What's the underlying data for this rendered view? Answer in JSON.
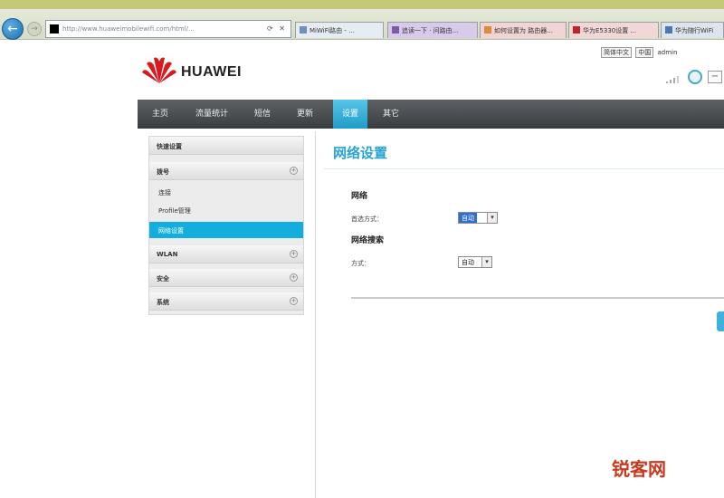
{
  "browser": {
    "address_url": "http://www.huaweimobilewifi.com/html/...",
    "address_controls": "⟳ ✕",
    "tabs": [
      {
        "label": "MiWiFi路由 - ..."
      },
      {
        "label": "追读一下 · 问路由..."
      },
      {
        "label": "如何设置为 路由器..."
      },
      {
        "label": "华为E5330设置 ..."
      },
      {
        "label": "华为随行WiFi"
      }
    ]
  },
  "header": {
    "brand": "HUAWEI",
    "language": "简体中文",
    "user_label": "admin",
    "util_select": "中国"
  },
  "nav": {
    "items": [
      {
        "label": "主页"
      },
      {
        "label": "流量统计"
      },
      {
        "label": "短信"
      },
      {
        "label": "更新"
      },
      {
        "label": "设置"
      },
      {
        "label": "其它"
      }
    ],
    "active_index": 4
  },
  "sidebar": {
    "sections": [
      {
        "label": "快速设置"
      },
      {
        "label": "拨号"
      },
      {
        "label": "WLAN"
      },
      {
        "label": "安全"
      },
      {
        "label": "系统"
      }
    ],
    "subitems": [
      {
        "label": "连接"
      },
      {
        "label": "Profile管理"
      },
      {
        "label": "网络设置"
      }
    ]
  },
  "main": {
    "title": "网络设置",
    "network": {
      "heading": "网络",
      "mode_label": "首选方式：",
      "mode_value": "自动"
    },
    "search": {
      "heading": "网络搜索",
      "mode_label": "方式：",
      "mode_value": "自动"
    }
  },
  "watermark": "锐客网"
}
